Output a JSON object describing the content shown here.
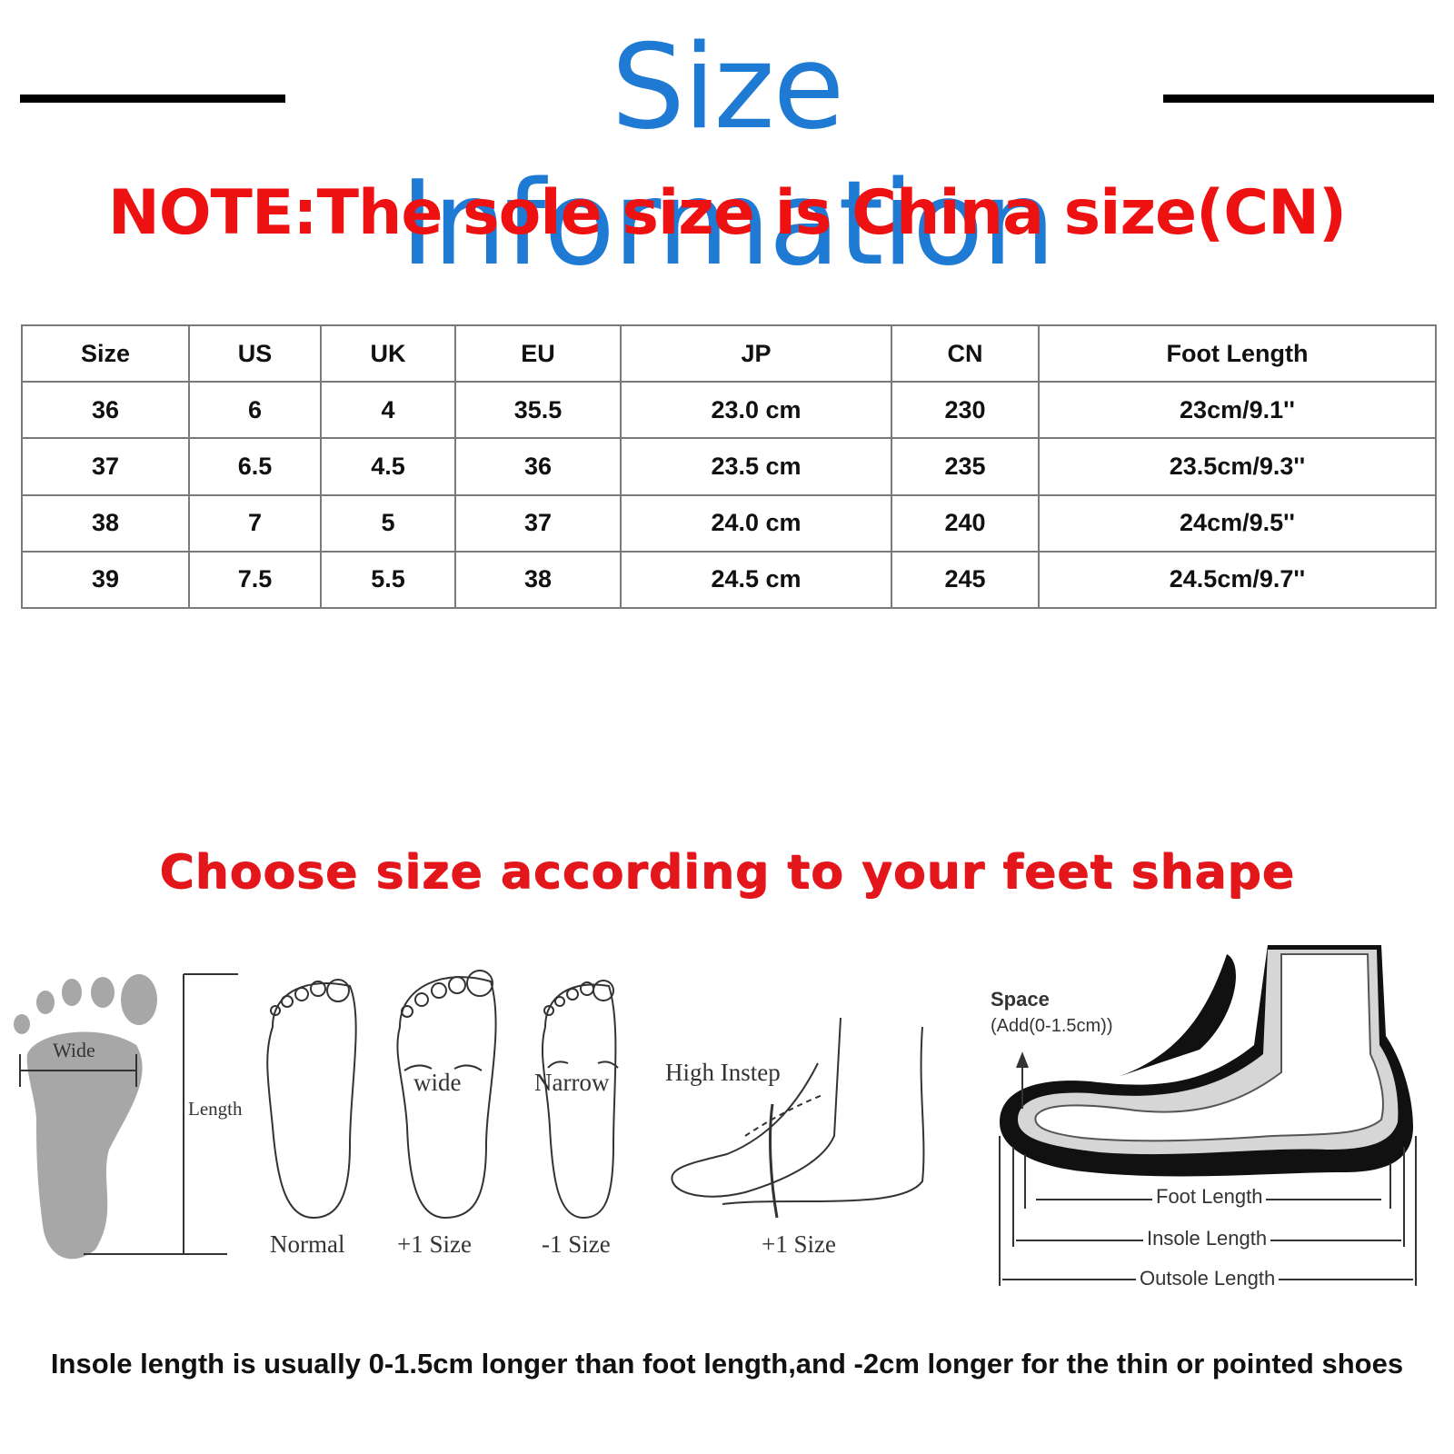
{
  "header": {
    "title": "Size Information",
    "note": "NOTE:The sole size is China size(CN)"
  },
  "size_table": {
    "columns": [
      "Size",
      "US",
      "UK",
      "EU",
      "JP",
      "CN",
      "Foot Length"
    ],
    "rows": [
      [
        "36",
        "6",
        "4",
        "35.5",
        "23.0 cm",
        "230",
        "23cm/9.1''"
      ],
      [
        "37",
        "6.5",
        "4.5",
        "36",
        "23.5 cm",
        "235",
        "23.5cm/9.3''"
      ],
      [
        "38",
        "7",
        "5",
        "37",
        "24.0 cm",
        "240",
        "24cm/9.5''"
      ],
      [
        "39",
        "7.5",
        "5.5",
        "38",
        "24.5 cm",
        "245",
        "24.5cm/9.7''"
      ]
    ]
  },
  "guide": {
    "heading": "Choose size according to your feet shape",
    "wide_label": "Wide",
    "length_label": "Length",
    "feet": [
      {
        "inner": "",
        "caption": "Normal"
      },
      {
        "inner": "wide",
        "caption": "+1 Size"
      },
      {
        "inner": "Narrow",
        "caption": "-1 Size"
      }
    ],
    "instep": {
      "label": "High Instep",
      "caption": "+1 Size"
    },
    "shoe": {
      "space_label": "Space",
      "space_sub": "(Add(0-1.5cm))",
      "foot_length": "Foot Length",
      "insole_length": "Insole Length",
      "outsole_length": "Outsole Length"
    }
  },
  "footer": {
    "text": "Insole length is usually 0-1.5cm longer than foot length,and -2cm longer for the thin or pointed shoes"
  },
  "colors": {
    "title": "#1f7ad4",
    "note": "#ee1111",
    "heading": "#e3161b"
  }
}
